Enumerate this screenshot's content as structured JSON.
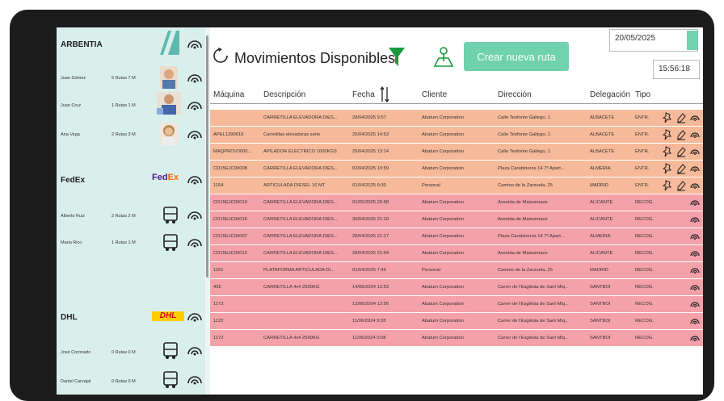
{
  "sidebar": {
    "groups": [
      {
        "company": "ARBENTIA",
        "members": [
          {
            "name": "Juan Gómez",
            "routes": "5 Rutas  7 M"
          },
          {
            "name": "Juan Cruz",
            "routes": "1 Rutas  1 M"
          },
          {
            "name": "Ana Vega",
            "routes": "2 Rutas  3 M"
          }
        ]
      },
      {
        "company": "FedEx",
        "logo": "FedEx",
        "members": [
          {
            "name": "Alberto Ruiz",
            "routes": "2 Rutas  2 M"
          },
          {
            "name": "Maria Rico",
            "routes": "1 Rutas  1 M"
          }
        ]
      },
      {
        "company": "DHL",
        "logo": "DHL",
        "members": [
          {
            "name": "José Coronado",
            "routes": "0 Rutas  0 M"
          },
          {
            "name": "Daniel Carvajal",
            "routes": "0 Rutas  0 M"
          }
        ]
      }
    ]
  },
  "header": {
    "title": "Movimientos Disponibles",
    "new_route_button": "Crear nueva ruta",
    "date": "20/05/2025",
    "time": "15:56:18"
  },
  "table": {
    "columns": [
      "Máquina",
      "Descripción",
      "Fecha",
      "Cliente",
      "Dirección",
      "Delegación",
      "Tipo"
    ],
    "rows": [
      {
        "maquina": "",
        "descripcion": "CARRETILLA ELEVADORA DIÉS...",
        "fecha": "28/04/2025 9:57",
        "cliente": "Abatum Corporation",
        "direccion": "Calle Teofonte Gallego, 1",
        "delegacion": "ALBACETE",
        "tipo": "ENTR."
      },
      {
        "maquina": "APEL1390019",
        "descripcion": "Carretillas elevadoras serie",
        "fecha": "25/04/2025 14:53",
        "cliente": "Abatum Corporation",
        "direccion": "Calle Teofonte Gallego, 1",
        "delegacion": "ALBACETE",
        "tipo": "ENTR."
      },
      {
        "maquina": "MAQPROV0000...",
        "descripcion": "APILADOR ELECTRICO 1000KGS",
        "fecha": "25/04/2025 13:14",
        "cliente": "Abatum Corporation",
        "direccion": "Calle Teofonte Gallego, 1",
        "delegacion": "ALBACETE",
        "tipo": "ENTR."
      },
      {
        "maquina": "CD15EJC00008",
        "descripcion": "CARRETILLA ELEVADORA DIÉS...",
        "fecha": "02/04/2025 10:59",
        "cliente": "Abatum Corporation",
        "direccion": "Plaza Carabineros 14 7º Apart...",
        "delegacion": "ALMERÍA",
        "tipo": "ENTR."
      },
      {
        "maquina": "1154",
        "descripcion": "ARTICULADA DIESEL 16 MT",
        "fecha": "01/04/2025 9:30",
        "cliente": "Personal",
        "direccion": "Camino de la Zarzuela, 25",
        "delegacion": "MADRID",
        "tipo": "ENTR."
      },
      {
        "maquina": "CD15EJC00010",
        "descripcion": "CARRETILLA ELEVADORA DIÉS...",
        "fecha": "01/05/2025 20:58",
        "cliente": "Abatum Corporation",
        "direccion": "Avenida de Maisonnave",
        "delegacion": "ALICANTE",
        "tipo": "RECOG."
      },
      {
        "maquina": "CD15EJC00016",
        "descripcion": "CARRETILLA ELEVADORA DIÉS...",
        "fecha": "30/04/2025 21:10",
        "cliente": "Abatum Corporation",
        "direccion": "Avenida de Maisonnave",
        "delegacion": "ALICANTE",
        "tipo": "RECOG."
      },
      {
        "maquina": "CD15EJC00007",
        "descripcion": "CARRETILLA ELEVADORA DIÉS...",
        "fecha": "28/04/2025 21:17",
        "cliente": "Abatum Corporation",
        "direccion": "Plaza Carabineros 14 7º Apart...",
        "delegacion": "ALMERÍA",
        "tipo": "RECOG."
      },
      {
        "maquina": "CD15EJC00012",
        "descripcion": "CARRETILLA ELEVADORA DIÉS...",
        "fecha": "28/04/2025 21:04",
        "cliente": "Abatum Corporation",
        "direccion": "Avenida de Maisonnave",
        "delegacion": "ALICANTE",
        "tipo": "RECOG."
      },
      {
        "maquina": "1151",
        "descripcion": "PLATAFORMA ARTICULADA DI...",
        "fecha": "01/04/2025 7:46",
        "cliente": "Personal",
        "direccion": "Camino de la Zarzuela, 25",
        "delegacion": "MADRID",
        "tipo": "RECOG."
      },
      {
        "maquina": "435",
        "descripcion": "CARRETILLA 4x4 2500KG",
        "fecha": "14/06/2024 13:53",
        "cliente": "Abatum Corporation",
        "direccion": "Carrer de l'Església de Sant Miq...",
        "delegacion": "SANTBOI",
        "tipo": "RECOG."
      },
      {
        "maquina": "1173",
        "descripcion": "",
        "fecha": "12/06/2024 12:56",
        "cliente": "Abatum Corporation",
        "direccion": "Carrer de l'Església de Sant Miq...",
        "delegacion": "SANTBOI",
        "tipo": "RECOG."
      },
      {
        "maquina": "1122",
        "descripcion": "",
        "fecha": "11/06/2024 9:28",
        "cliente": "Abatum Corporation",
        "direccion": "Carrer de l'Església de Sant Miq...",
        "delegacion": "SANTBOI",
        "tipo": "RECOG."
      },
      {
        "maquina": "1172",
        "descripcion": "CARRETILLA 4x4 2500KG",
        "fecha": "11/06/2024 0:08",
        "cliente": "Abatum Corporation",
        "direccion": "Carrer de l'Església de Sant Miq...",
        "delegacion": "SANTBOI",
        "tipo": "RECOG."
      }
    ]
  },
  "colors": {
    "sidebar_bg": "#d9efec",
    "accent": "#6fd1ad",
    "filter_green": "#1a9a3c",
    "row_entrega": "#f6b999",
    "row_recogida": "#f4a1a9"
  }
}
